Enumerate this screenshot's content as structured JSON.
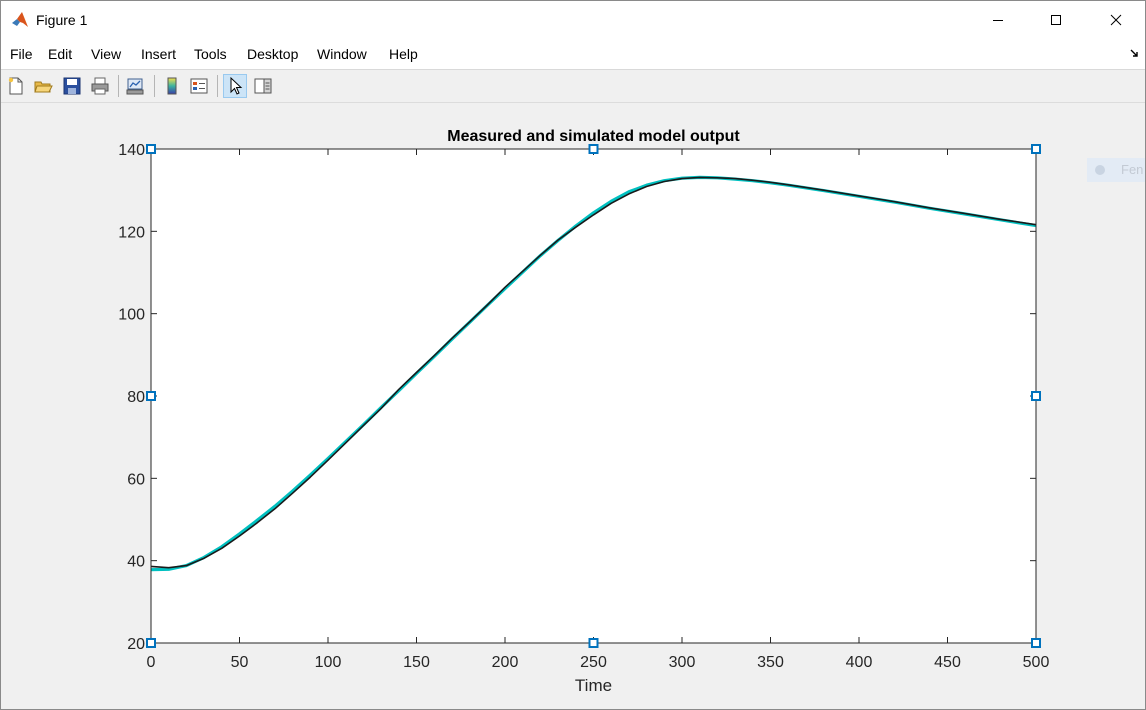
{
  "window": {
    "title": "Figure 1"
  },
  "menubar": {
    "items": [
      "File",
      "Edit",
      "View",
      "Insert",
      "Tools",
      "Desktop",
      "Window",
      "Help"
    ]
  },
  "toolbar": {
    "buttons": [
      "new-figure-icon",
      "open-file-icon",
      "save-icon",
      "print-icon",
      "link-plot-icon",
      "insert-colorbar-icon",
      "insert-legend-icon",
      "edit-plot-icon",
      "property-inspector-icon"
    ],
    "active": "edit-plot-icon"
  },
  "legend_ghost": {
    "text": "Fen"
  },
  "colors": {
    "measured": "#00c0c0",
    "simulated": "#1a1a1a",
    "selection_handle": "#0072bd",
    "active_tool": "#cce4f7"
  },
  "chart_data": {
    "type": "line",
    "title": "Measured and simulated model output",
    "xlabel": "Time",
    "ylabel": "",
    "xlim": [
      0,
      500
    ],
    "ylim": [
      20,
      140
    ],
    "xticks": [
      0,
      50,
      100,
      150,
      200,
      250,
      300,
      350,
      400,
      450,
      500
    ],
    "yticks": [
      20,
      40,
      60,
      80,
      100,
      120,
      140
    ],
    "grid": false,
    "series": [
      {
        "color": "#00c0c0",
        "line_width": "thick",
        "x": [
          0,
          10,
          20,
          30,
          40,
          50,
          60,
          70,
          80,
          90,
          100,
          110,
          120,
          130,
          140,
          150,
          160,
          170,
          180,
          190,
          200,
          210,
          220,
          230,
          240,
          250,
          260,
          270,
          280,
          290,
          300,
          310,
          320,
          330,
          340,
          350,
          360,
          380,
          400,
          420,
          440,
          460,
          480,
          500
        ],
        "y": [
          37.8,
          37.9,
          38.8,
          40.8,
          43.4,
          46.5,
          49.8,
          53.2,
          56.9,
          60.8,
          64.8,
          68.9,
          73.0,
          77.2,
          81.3,
          85.5,
          89.6,
          93.8,
          97.9,
          102.0,
          106.1,
          110.1,
          114.1,
          117.8,
          121.3,
          124.5,
          127.3,
          129.6,
          131.2,
          132.3,
          132.9,
          133.1,
          133.0,
          132.7,
          132.3,
          131.8,
          131.2,
          129.9,
          128.5,
          127.1,
          125.6,
          124.2,
          122.8,
          121.4
        ]
      },
      {
        "color": "#1a1a1a",
        "line_width": "thin-noisy",
        "x": [
          0,
          10,
          20,
          30,
          40,
          50,
          60,
          70,
          80,
          90,
          100,
          110,
          120,
          130,
          140,
          150,
          160,
          170,
          180,
          190,
          200,
          210,
          220,
          230,
          240,
          250,
          260,
          270,
          280,
          290,
          300,
          310,
          320,
          330,
          340,
          350,
          360,
          380,
          400,
          420,
          440,
          460,
          480,
          500
        ],
        "y": [
          38.6,
          38.3,
          38.8,
          40.6,
          43.0,
          46.0,
          49.2,
          52.6,
          56.4,
          60.3,
          64.4,
          68.6,
          72.8,
          77.0,
          81.6,
          85.7,
          89.8,
          94.0,
          98.0,
          102.1,
          106.4,
          110.3,
          114.2,
          117.9,
          121.0,
          124.0,
          126.8,
          129.1,
          130.9,
          132.1,
          132.8,
          133.1,
          133.0,
          132.8,
          132.4,
          131.9,
          131.3,
          130.0,
          128.6,
          127.2,
          125.7,
          124.3,
          122.9,
          121.6
        ]
      }
    ]
  }
}
